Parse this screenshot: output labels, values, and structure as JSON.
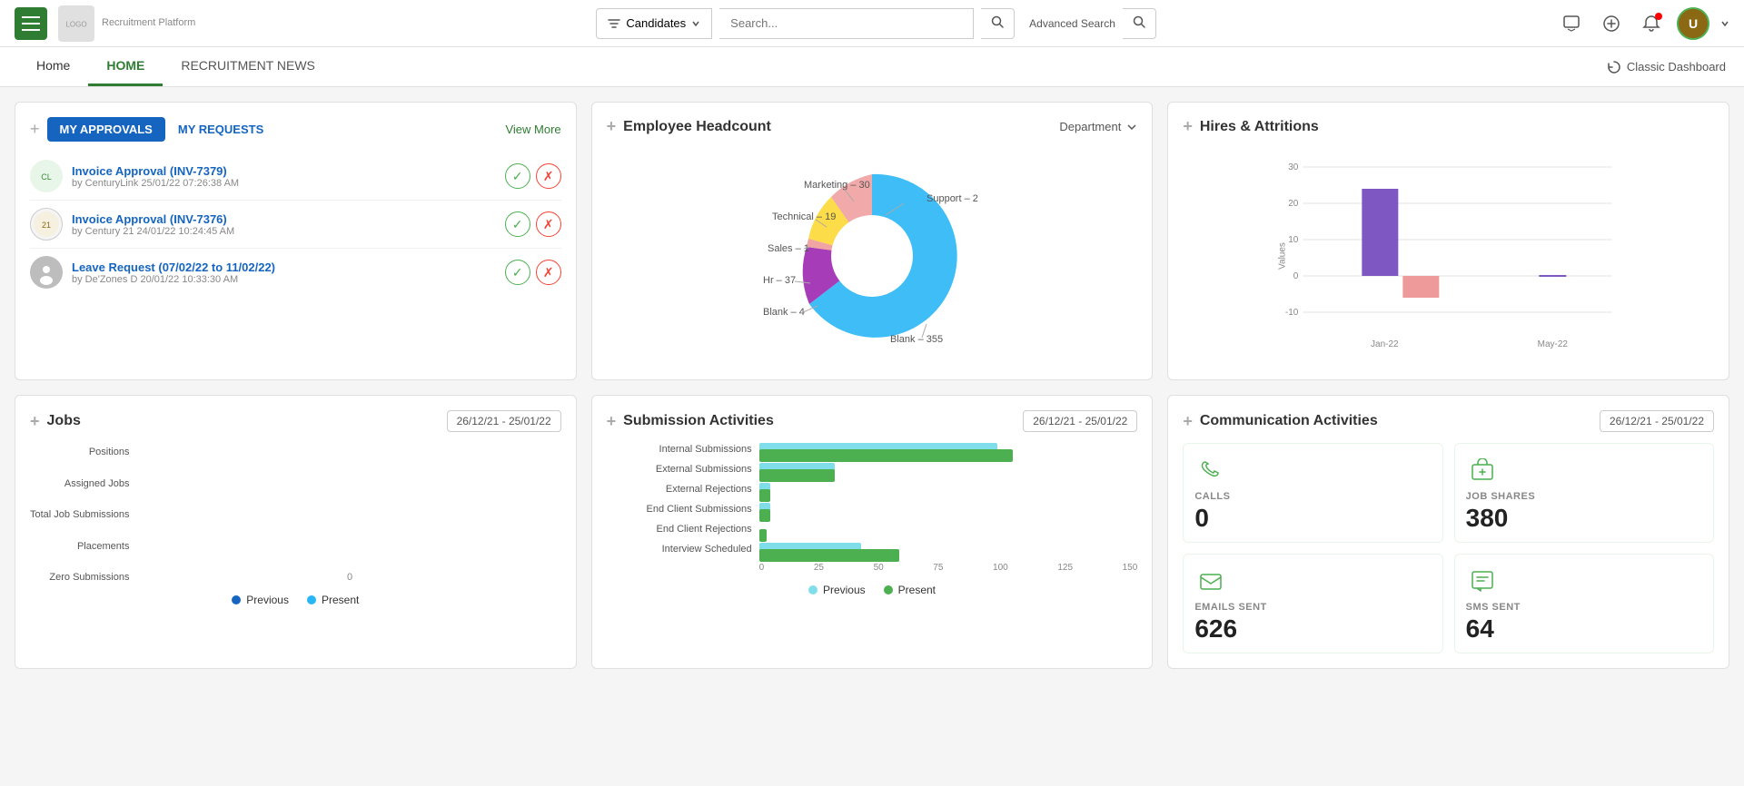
{
  "navbar": {
    "menu_label": "Menu",
    "logo_alt": "Company Logo",
    "logo_subtext": "Recruitment Platform",
    "search_placeholder": "Search...",
    "filter_label": "Candidates",
    "advanced_search_label": "Advanced Search",
    "classic_dashboard_label": "Classic Dashboard"
  },
  "tabs": {
    "home_label": "Home",
    "tab_home_label": "HOME",
    "tab_recruitment_news_label": "RECRUITMENT NEWS"
  },
  "approvals": {
    "title": "MY APPROVALS",
    "requests_label": "MY REQUESTS",
    "view_more_label": "View More",
    "items": [
      {
        "title": "Invoice Approval (INV-7379)",
        "subtitle": "by CenturyLink 25/01/22 07:26:38 AM",
        "avatar_type": "centurylink"
      },
      {
        "title": "Invoice Approval (INV-7376)",
        "subtitle": "by Century 21 24/01/22 10:24:45 AM",
        "avatar_type": "century21"
      },
      {
        "title": "Leave Request (07/02/22 to 11/02/22)",
        "subtitle": "by De'Zones D 20/01/22 10:33:30 AM",
        "avatar_type": "person"
      }
    ]
  },
  "headcount": {
    "title": "Employee Headcount",
    "filter_label": "Department",
    "segments": [
      {
        "label": "Blank – 355",
        "value": 355,
        "color": "#29b6f6",
        "percent": 72
      },
      {
        "label": "Hr – 37",
        "value": 37,
        "color": "#ab47bc",
        "percent": 9
      },
      {
        "label": "Sales – 1",
        "value": 1,
        "color": "#ef9a9a",
        "percent": 0.5
      },
      {
        "label": "Technical – 19",
        "value": 19,
        "color": "#ffcc02",
        "percent": 5
      },
      {
        "label": "Marketing – 30",
        "value": 30,
        "color": "#ef9a9a",
        "percent": 7.5
      },
      {
        "label": "Support – 2",
        "value": 2,
        "color": "#6d4c41",
        "percent": 0.5
      }
    ]
  },
  "hires_attritions": {
    "title": "Hires & Attritions",
    "y_labels": [
      "30",
      "20",
      "10",
      "0",
      "-10"
    ],
    "x_labels": [
      "Jan-22",
      "May-22"
    ],
    "bars": [
      {
        "label": "Jan-22",
        "hires": 24,
        "attritions": -5,
        "color_hire": "#7e57c2",
        "color_attr": "#ef9a9a"
      },
      {
        "label": "May-22",
        "hires": 0,
        "attritions": 0,
        "color_hire": "#7e57c2",
        "color_attr": "#ef9a9a"
      }
    ],
    "values_label": "Values"
  },
  "jobs": {
    "title": "Jobs",
    "date_range": "26/12/21 - 25/01/22",
    "y_labels": [
      "Positions",
      "Assigned Jobs",
      "Total Job Submissions",
      "Placements",
      "Zero Submissions"
    ],
    "x_label": "0",
    "legend": {
      "previous_label": "Previous",
      "present_label": "Present",
      "previous_color": "#1565c0",
      "present_color": "#29b6f6"
    }
  },
  "submission_activities": {
    "title": "Submission Activities",
    "date_range": "26/12/21 - 25/01/22",
    "bars": [
      {
        "label": "Internal Submissions",
        "previous": 95,
        "present": 100
      },
      {
        "label": "External Submissions",
        "previous": 30,
        "present": 30
      },
      {
        "label": "External Rejections",
        "previous": 5,
        "present": 5
      },
      {
        "label": "End Client Submissions",
        "previous": 5,
        "present": 5
      },
      {
        "label": "End Client Rejections",
        "previous": 0,
        "present": 3
      },
      {
        "label": "Interview Scheduled",
        "previous": 40,
        "present": 55
      }
    ],
    "x_labels": [
      "0",
      "25",
      "50",
      "75",
      "100",
      "125",
      "150"
    ],
    "legend": {
      "previous_label": "Previous",
      "present_label": "Present",
      "previous_color": "#80deea",
      "present_color": "#4CAF50"
    }
  },
  "communication_activities": {
    "title": "Communication Activities",
    "date_range": "26/12/21 - 25/01/22",
    "items": [
      {
        "label": "CALLS",
        "value": "0",
        "icon": "phone"
      },
      {
        "label": "JOB SHARES",
        "value": "380",
        "icon": "share"
      },
      {
        "label": "EMAILS SENT",
        "value": "626",
        "icon": "email"
      },
      {
        "label": "SMS SENT",
        "value": "64",
        "icon": "sms"
      }
    ]
  }
}
